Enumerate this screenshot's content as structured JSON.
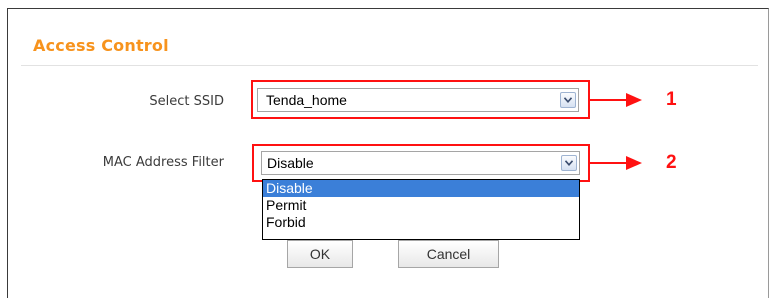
{
  "panel": {
    "title": "Access Control"
  },
  "form": {
    "ssid": {
      "label": "Select SSID",
      "value": "Tenda_home"
    },
    "mac_filter": {
      "label": "MAC Address Filter",
      "value": "Disable",
      "options": [
        "Disable",
        "Permit",
        "Forbid"
      ],
      "highlighted_option": "Disable"
    }
  },
  "annotations": {
    "callout_1": "1",
    "callout_2": "2",
    "color": "#ff1111"
  },
  "buttons": {
    "ok": "OK",
    "cancel": "Cancel"
  },
  "colors": {
    "title": "#f7931d",
    "option_highlight": "#3b7fd8"
  },
  "icons": {
    "dropdown": "chevron-down-icon",
    "arrow": "arrow-right-icon"
  }
}
